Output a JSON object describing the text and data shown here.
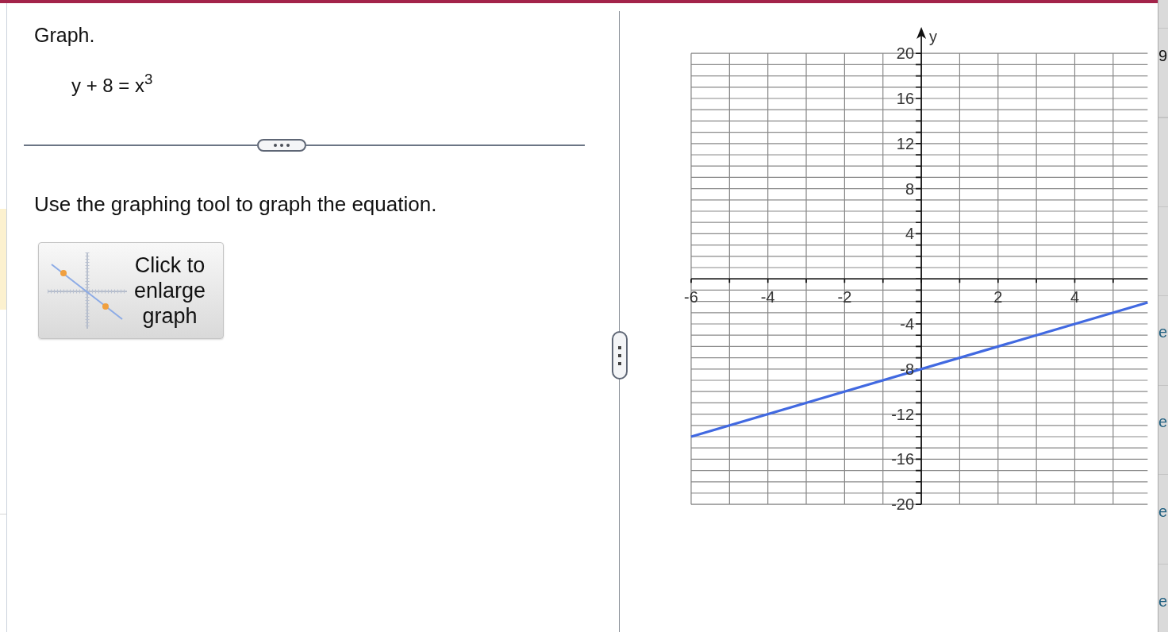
{
  "question": {
    "title": "Graph.",
    "equation": "y + 8 = x$^{3}$"
  },
  "instruction": "Use the graphing tool to graph the equation.",
  "enlarge_button": {
    "label": "Click to enlarge graph"
  },
  "graph": {
    "chart_data": [
      {
        "type": "line",
        "ylabel": "y",
        "x": [
          -6,
          5.9
        ],
        "values": [
          -14,
          -2.1
        ],
        "color": "#4169e1",
        "xlim": [
          -6,
          5.9
        ],
        "ylim": [
          -20,
          20
        ],
        "xticks": [
          -6,
          -4,
          -2,
          2,
          4
        ],
        "yticks": [
          -20,
          -16,
          -12,
          -8,
          -4,
          4,
          8,
          12,
          16,
          20
        ],
        "grid": true
      }
    ]
  },
  "side_panel": {
    "items": [
      {
        "kind": "label",
        "text": "9"
      },
      {
        "kind": "link",
        "text": "e"
      },
      {
        "kind": "link",
        "text": "e"
      },
      {
        "kind": "link",
        "text": "e"
      },
      {
        "kind": "link",
        "text": "e"
      }
    ]
  }
}
